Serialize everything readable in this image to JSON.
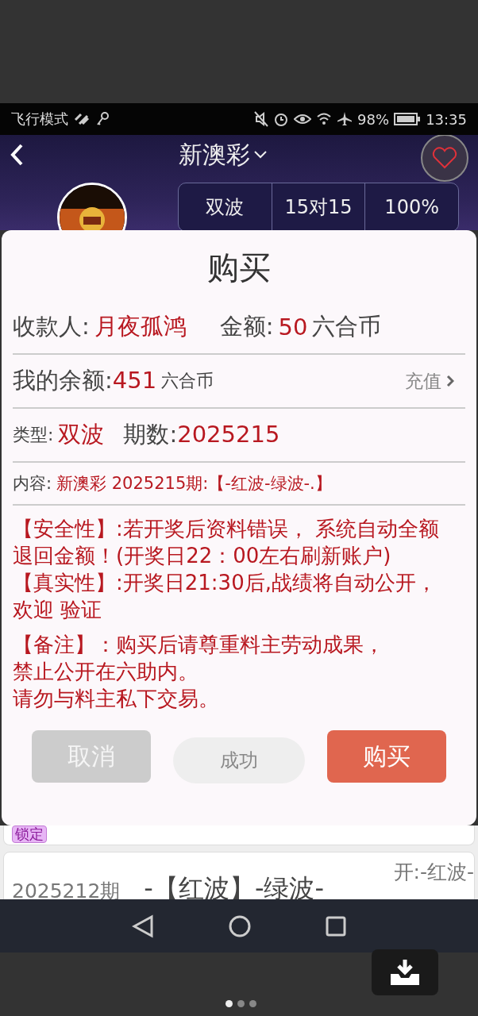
{
  "status_bar": {
    "mode": "飞行模式",
    "battery": "98%",
    "time": "13:35"
  },
  "header": {
    "title": "新澳彩",
    "stats": [
      "双波",
      "15对15",
      "100%"
    ]
  },
  "dialog": {
    "title": "购买",
    "payee_label": "收款人:",
    "payee": "月夜孤鸿",
    "amount_label": "金额:",
    "amount": "50",
    "amount_unit": "六合币",
    "balance_label": "我的余额:",
    "balance": "451",
    "balance_unit": "六合币",
    "recharge": "充值",
    "type_label": "类型:",
    "type": "双波",
    "period_label": "期数:",
    "period": "2025215",
    "content_label": "内容:",
    "content": "新澳彩 2025215期:【-红波-绿波-.】",
    "notices": [
      {
        "lines": [
          "【安全性】:若开奖后资料错误， 系统自动全额退回金额！(开奖日22：00左右刷新账户)",
          "【真实性】:开奖日21:30后,战绩将自动公开，欢迎 验证"
        ]
      },
      {
        "lines": [
          "【备注】：购买后请尊重料主劳动成果，",
          "禁止公开在六助内。",
          "请勿与料主私下交易。"
        ]
      }
    ],
    "buttons": [
      {
        "label": "取消",
        "kind": "cancel"
      },
      {
        "label": "成功",
        "kind": "status"
      },
      {
        "label": "购买",
        "kind": "confirm"
      }
    ]
  },
  "list": {
    "badge": "锁定",
    "rows": [
      {
        "period": "2025212期",
        "content": "-【红波】-绿波-",
        "result": "开:-红波-"
      }
    ]
  },
  "pager": [
    {
      "selected": true
    },
    {
      "selected": false
    },
    {
      "selected": false
    }
  ]
}
